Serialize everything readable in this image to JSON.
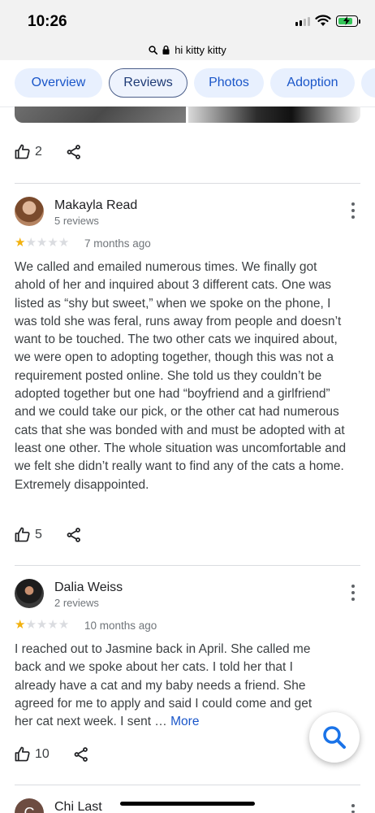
{
  "status": {
    "time": "10:26"
  },
  "browser": {
    "url": "hi kitty kitty",
    "search_icon": "search-icon",
    "lock_icon": "lock-icon"
  },
  "tabs": [
    {
      "label": "Overview",
      "active": false
    },
    {
      "label": "Reviews",
      "active": true
    },
    {
      "label": "Photos",
      "active": false
    },
    {
      "label": "Adoption",
      "active": false
    }
  ],
  "top_review": {
    "likes": "2"
  },
  "reviews": [
    {
      "name": "Makayla Read",
      "count": "5 reviews",
      "rating": 1,
      "ago": "7 months ago",
      "text": "We called and emailed numerous times. We finally got ahold of her and inquired about 3 different cats. One was listed as “shy but sweet,” when we spoke on the phone, I was told she was feral, runs away from people and doesn’t want to be touched. The two other cats we inquired about, we were open to adopting together, though this was not a requirement posted online. She told us they couldn’t be adopted together but one had “boyfriend and a girlfriend” and we could take our pick, or the other cat had numerous cats that she was bonded with and must be adopted with at least one other. The whole situation was uncomfortable and we felt she didn’t really want to find any of the cats a home. Extremely disappointed.",
      "likes": "5"
    },
    {
      "name": "Dalia Weiss",
      "count": "2 reviews",
      "rating": 1,
      "ago": "10 months ago",
      "text": "I reached out to Jasmine back in April.  She called me back and we spoke about her cats.  I told her that I already have a cat and my baby needs a friend.  She agreed for me to apply and said I could come and get her cat next week. I sent …",
      "more": "More",
      "likes": "10"
    },
    {
      "name": "Chi Last",
      "avatar_letter": "C"
    }
  ],
  "colors": {
    "star": "#f2b10e",
    "link": "#1a56c9",
    "tab_bg": "#e8f0fe"
  }
}
